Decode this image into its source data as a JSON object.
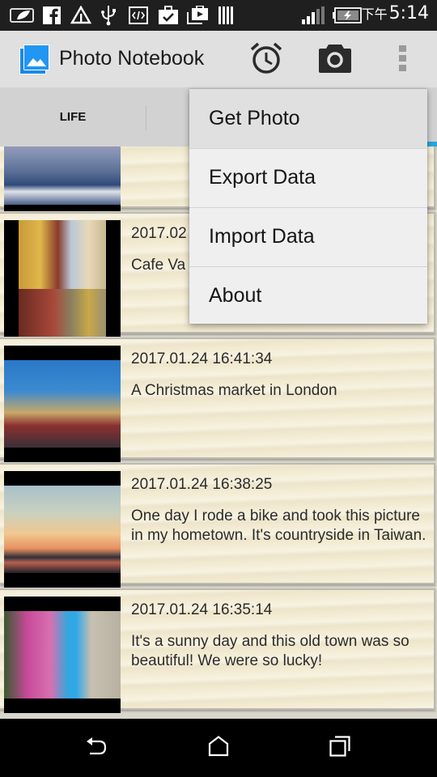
{
  "status_bar": {
    "left_icons": [
      "battery-saver-icon",
      "facebook-icon",
      "warning-icon",
      "usb-icon",
      "developer-icon",
      "task-done-icon",
      "media-player-icon",
      "barcode-icon"
    ],
    "ampm": "下午",
    "time": "5:14",
    "right_icons": [
      "signal-icon",
      "battery-charging-icon"
    ]
  },
  "action_bar": {
    "title": "Photo Notebook",
    "actions": [
      {
        "name": "alarm",
        "icon": "alarm-clock-icon"
      },
      {
        "name": "camera",
        "icon": "camera-icon"
      },
      {
        "name": "overflow",
        "icon": "more-vert-icon"
      }
    ]
  },
  "tabs": {
    "items": [
      {
        "label": "LIFE",
        "selected": false
      },
      {
        "label": "",
        "selected": false
      },
      {
        "label": "",
        "selected": true
      }
    ],
    "accent_color": "#29a7df"
  },
  "overflow_menu": {
    "items": [
      {
        "label": "Get Photo",
        "pressed": true
      },
      {
        "label": "Export Data",
        "pressed": false
      },
      {
        "label": "Import Data",
        "pressed": false
      },
      {
        "label": "About",
        "pressed": false
      }
    ]
  },
  "entries": [
    {
      "date": "",
      "text": "",
      "photo": "seaside-beach-chairs"
    },
    {
      "date": "2017.02",
      "text": "Cafe Va",
      "photo": "cafe-street"
    },
    {
      "date": "2017.01.24 16:41:34",
      "text": "A Christmas market in London",
      "photo": "christmas-market"
    },
    {
      "date": "2017.01.24 16:38:25",
      "text": "One day I rode a bike and took this picture in my hometown. It's countryside in Taiwan.",
      "photo": "sunset-countryside"
    },
    {
      "date": "2017.01.24 16:35:14",
      "text": "It's a sunny day and this old town was so beautiful! We were so lucky!",
      "photo": "old-town-flowers"
    }
  ],
  "nav_bar": {
    "buttons": [
      {
        "name": "back",
        "icon": "back-icon"
      },
      {
        "name": "home",
        "icon": "home-icon"
      },
      {
        "name": "recents",
        "icon": "recents-icon"
      }
    ]
  }
}
